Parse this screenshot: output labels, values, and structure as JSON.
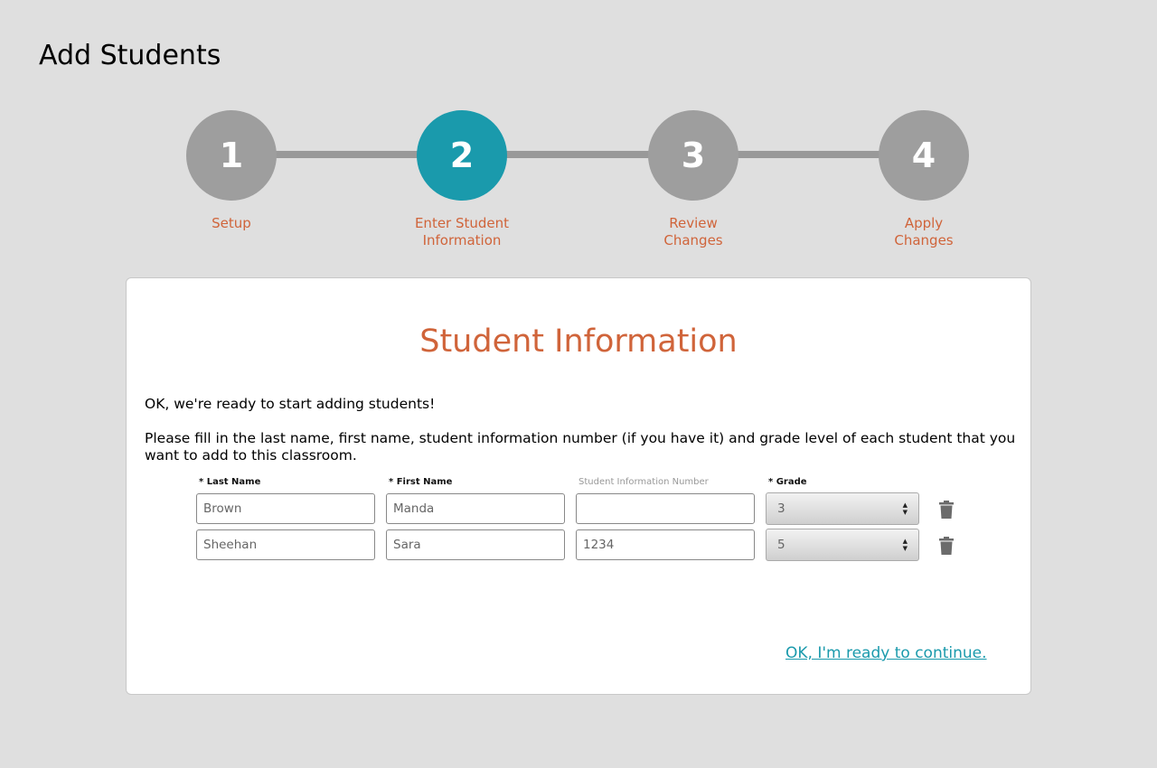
{
  "page": {
    "title": "Add Students"
  },
  "stepper": {
    "steps": [
      {
        "number": "1",
        "label_line1": "Setup",
        "label_line2": "",
        "active": false
      },
      {
        "number": "2",
        "label_line1": "Enter Student",
        "label_line2": "Information",
        "active": true
      },
      {
        "number": "3",
        "label_line1": "Review",
        "label_line2": "Changes",
        "active": false
      },
      {
        "number": "4",
        "label_line1": "Apply",
        "label_line2": "Changes",
        "active": false
      }
    ]
  },
  "card": {
    "title": "Student Information",
    "intro": "OK, we're ready to start adding students!",
    "instructions": "Please fill in the last name, first name, student information number (if you have it) and grade level of each student that you want to add to this classroom.",
    "columns": {
      "last_name": "* Last Name",
      "first_name": "* First Name",
      "student_number": "Student Information Number",
      "grade": "* Grade"
    },
    "rows": [
      {
        "last_name": "Brown",
        "first_name": "Manda",
        "student_number": "",
        "grade": "3"
      },
      {
        "last_name": "Sheehan",
        "first_name": "Sara",
        "student_number": "1234",
        "grade": "5"
      }
    ],
    "continue_label": "OK, I'm ready to continue."
  },
  "colors": {
    "background": "#dfdfdf",
    "accent_teal": "#1a9aac",
    "accent_orange": "#d0643a",
    "step_inactive": "#9e9e9e"
  },
  "icons": {
    "delete": "trash-icon",
    "select_arrows": "updown-arrows-icon"
  }
}
